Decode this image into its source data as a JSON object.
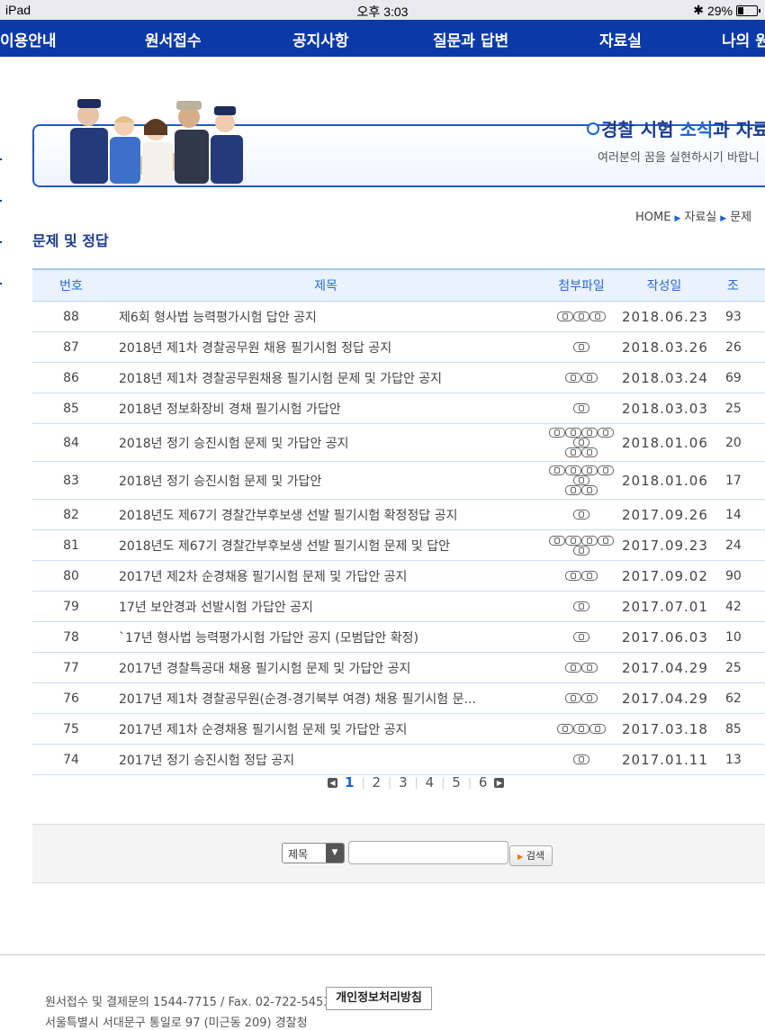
{
  "status_bar": {
    "device": "iPad",
    "time": "오후 3:03",
    "battery": "29%"
  },
  "nav": [
    "이용안내",
    "원서접수",
    "공지사항",
    "질문과 답변",
    "자료실",
    "나의 원"
  ],
  "banner": {
    "title_a": "경찰 시험 ",
    "title_b": "소식",
    "title_c": "과 자료",
    "subtitle": "여러분의 꿈을 실현하시기 바랍니"
  },
  "breadcrumb": [
    "HOME",
    "자료실",
    "문제"
  ],
  "page_title": "문제 및 정답",
  "table": {
    "headers": [
      "번호",
      "제목",
      "첨부파일",
      "작성일",
      "조"
    ],
    "rows": [
      {
        "no": "88",
        "title": "제6회 형사법 능력평가시험 답안 공지",
        "files": 3,
        "date": "2018.06.23",
        "views": "93"
      },
      {
        "no": "87",
        "title": "2018년 제1차 경찰공무원 채용 필기시험 정답 공지",
        "files": 1,
        "date": "2018.03.26",
        "views": "26"
      },
      {
        "no": "86",
        "title": "2018년 제1차 경찰공무원채용 필기시험 문제 및 가답안 공지",
        "files": 2,
        "date": "2018.03.24",
        "views": "69"
      },
      {
        "no": "85",
        "title": "2018년 정보화장비 경채 필기시험 가답안",
        "files": 1,
        "date": "2018.03.03",
        "views": "25"
      },
      {
        "no": "84",
        "title": "2018년 정기 승진시험 문제 및 가답안 공지",
        "files": 7,
        "date": "2018.01.06",
        "views": "20"
      },
      {
        "no": "83",
        "title": "2018년 정기 승진시험 문제 및 가답안",
        "files": 7,
        "date": "2018.01.06",
        "views": "17"
      },
      {
        "no": "82",
        "title": "2018년도 제67기 경찰간부후보생 선발 필기시험 확정정답 공지",
        "files": 1,
        "date": "2017.09.26",
        "views": "14"
      },
      {
        "no": "81",
        "title": "2018년도 제67기 경찰간부후보생 선발 필기시험 문제 및 답안",
        "files": 5,
        "date": "2017.09.23",
        "views": "24"
      },
      {
        "no": "80",
        "title": "2017년 제2차 순경채용 필기시험 문제 및 가답안 공지",
        "files": 2,
        "date": "2017.09.02",
        "views": "90"
      },
      {
        "no": "79",
        "title": "17년 보안경과 선발시험 가답안 공지",
        "files": 1,
        "date": "2017.07.01",
        "views": "42"
      },
      {
        "no": "78",
        "title": "`17년 형사법 능력평가시험 가답안 공지 (모범답안 확정)",
        "files": 1,
        "date": "2017.06.03",
        "views": "10"
      },
      {
        "no": "77",
        "title": "2017년 경찰특공대 채용 필기시험 문제 및 가답안 공지",
        "files": 2,
        "date": "2017.04.29",
        "views": "25"
      },
      {
        "no": "76",
        "title": "2017년 제1차 경찰공무원(순경-경기북부 여경) 채용 필기시험 문...",
        "files": 2,
        "date": "2017.04.29",
        "views": "62"
      },
      {
        "no": "75",
        "title": "2017년 제1차 순경채용 필기시험 문제 및 가답안 공지",
        "files": 3,
        "date": "2017.03.18",
        "views": "85"
      },
      {
        "no": "74",
        "title": "2017년 정기 승진시험 정답 공지",
        "files": 1,
        "date": "2017.01.11",
        "views": "13"
      }
    ]
  },
  "pagination": {
    "pages": [
      "1",
      "2",
      "3",
      "4",
      "5",
      "6"
    ],
    "current": "1"
  },
  "search": {
    "field": "제목",
    "button": "검색",
    "value": ""
  },
  "footer": {
    "contact": "원서접수 및 결제문의 1544-7715 / Fax. 02-722-5453",
    "privacy": "개인정보처리방침",
    "address": "서울특별시 서대문구 통일로 97 (미근동 209) 경찰청"
  },
  "colors": {
    "nav_bg": "#0a3aa8",
    "accent": "#1a62d0",
    "title": "#1a3d8f"
  }
}
